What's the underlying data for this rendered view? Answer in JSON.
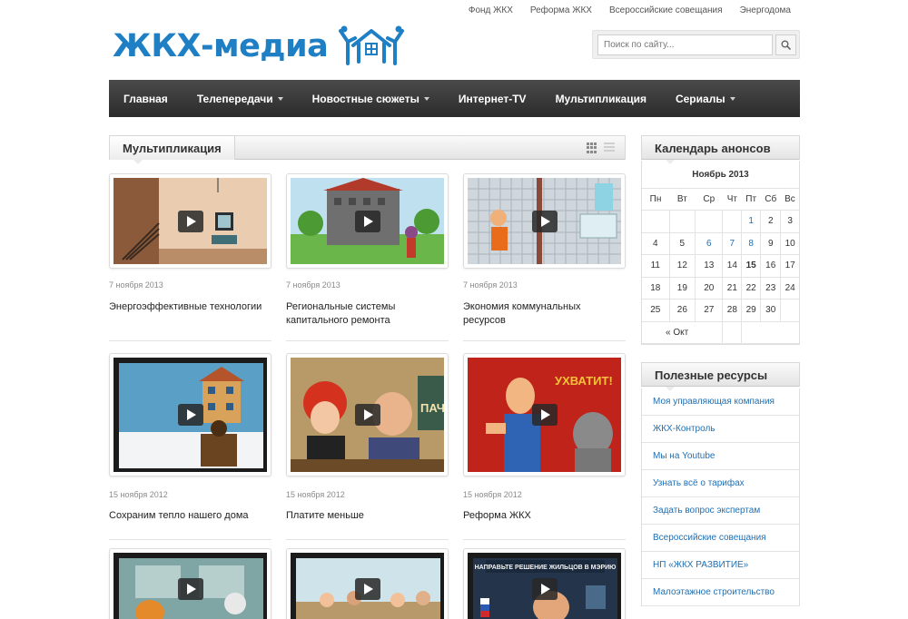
{
  "top_links": [
    "Фонд ЖКХ",
    "Реформа ЖКХ",
    "Всероссийские совещания",
    "Энергодома"
  ],
  "logo": {
    "text": "ЖКХ-медиа",
    "color": "#1f7fc4"
  },
  "search": {
    "placeholder": "Поиск по сайту...",
    "icon": "magnifier-icon"
  },
  "nav": {
    "items": [
      {
        "label": "Главная",
        "dropdown": false
      },
      {
        "label": "Телепередачи",
        "dropdown": true
      },
      {
        "label": "Новостные сюжеты",
        "dropdown": true
      },
      {
        "label": "Интернет-TV",
        "dropdown": false
      },
      {
        "label": "Мультипликация",
        "dropdown": false
      },
      {
        "label": "Сериалы",
        "dropdown": true
      }
    ]
  },
  "main": {
    "section_title": "Мультипликация",
    "view_icons": [
      "grid-view-icon",
      "list-view-icon"
    ],
    "cards": [
      {
        "date": "7 ноября 2013",
        "title": "Энергоэффективные технологии"
      },
      {
        "date": "7 ноября 2013",
        "title": "Региональные системы капитального ремонта"
      },
      {
        "date": "7 ноября 2013",
        "title": "Экономия коммунальных ресурсов"
      },
      {
        "date": "15 ноября 2012",
        "title": "Сохраним тепло нашего дома"
      },
      {
        "date": "15 ноября 2012",
        "title": "Платите меньше"
      },
      {
        "date": "15 ноября 2012",
        "title": "Реформа ЖКХ"
      },
      {
        "date": "",
        "title": ""
      },
      {
        "date": "",
        "title": ""
      },
      {
        "date": "",
        "title": ""
      }
    ],
    "thumb_texts": {
      "enough": "УХВАТИТ!",
      "banner": "НАПРАВЬТЕ РЕШЕНИЕ ЖИЛЬЦОВ В МЭРИЮ",
      "sign": "ПАЧ"
    }
  },
  "sidebar": {
    "calendar": {
      "title": "Календарь анонсов",
      "month": "Ноябрь 2013",
      "weekdays": [
        "Пн",
        "Вт",
        "Ср",
        "Чт",
        "Пт",
        "Сб",
        "Вс"
      ],
      "weeks": [
        [
          "",
          "",
          "",
          "",
          "1",
          "2",
          "3"
        ],
        [
          "4",
          "5",
          "6",
          "7",
          "8",
          "9",
          "10"
        ],
        [
          "11",
          "12",
          "13",
          "14",
          "15",
          "16",
          "17"
        ],
        [
          "18",
          "19",
          "20",
          "21",
          "22",
          "23",
          "24"
        ],
        [
          "25",
          "26",
          "27",
          "28",
          "29",
          "30",
          ""
        ]
      ],
      "linked_days": [
        "1",
        "6",
        "7",
        "8"
      ],
      "today": "15",
      "prev_label": "« Окт"
    },
    "resources": {
      "title": "Полезные ресурсы",
      "items": [
        "Моя управляющая компания",
        "ЖКХ-Контроль",
        "Мы на Youtube",
        "Узнать всё о тарифах",
        "Задать вопрос экспертам",
        "Всероссийские совещания",
        "НП «ЖКХ РАЗВИТИЕ»",
        "Малоэтажное строительство"
      ]
    }
  },
  "colors": {
    "accent": "#1f7fc4",
    "link": "#1f6fb4",
    "nav_bg": "#333333"
  }
}
